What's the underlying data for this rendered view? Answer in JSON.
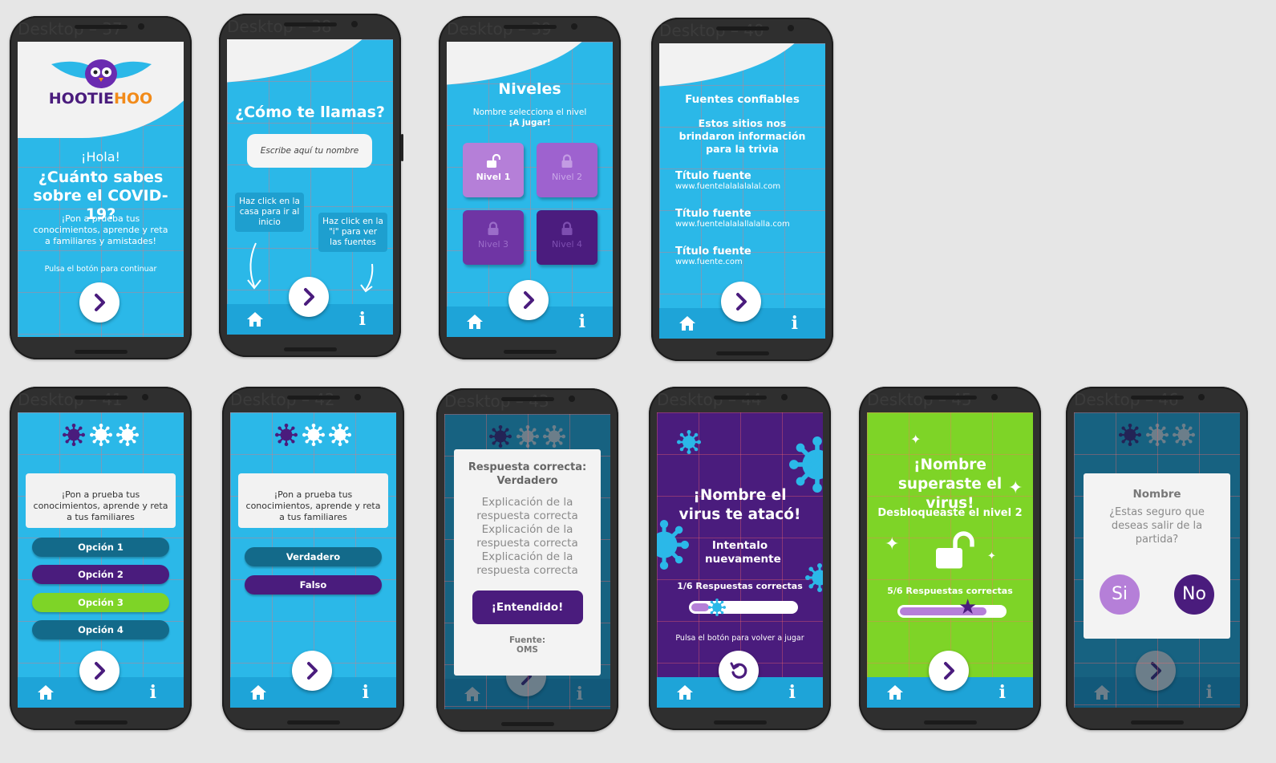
{
  "ghost_labels": [
    "Desktop – 37",
    "Desktop – 38",
    "Desktop – 39",
    "Desktop – 40",
    "Desktop – 41",
    "Desktop – 42",
    "Desktop – 43",
    "Desktop – 44",
    "Desktop – 45",
    "Desktop – 46"
  ],
  "colors": {
    "cyan": "#2bb8e8",
    "navbar": "#1ea4d8",
    "purple": "#4a1c7d",
    "green": "#7ed427",
    "teal": "#136a8a"
  },
  "s1": {
    "logo_hootie": "HOOTIE",
    "logo_hoo": "HOO",
    "greeting": "¡Hola!",
    "title": "¿Cuánto sabes sobre el COVID-19?",
    "subtitle": "¡Pon a prueba tus conocimientos, aprende y reta a familiares y amistades!",
    "hint": "Pulsa el botón para continuar"
  },
  "s2": {
    "title": "¿Cómo te llamas?",
    "name_placeholder": "Escribe aquí tu nombre",
    "tip_home": "Haz click en la casa para ir al inicio",
    "tip_info": "Haz click en la \"i\" para ver las fuentes"
  },
  "s3": {
    "title": "Niveles",
    "subtitle": "Nombre selecciona el nivel",
    "subtitle_bold": "¡A jugar!",
    "levels": [
      "Nivel 1",
      "Nivel 2",
      "Nivel 3",
      "Nivel 4"
    ]
  },
  "s4": {
    "title": "Fuentes confiables",
    "subtitle": "Estos sitios nos brindaron información para la trivia",
    "sources": [
      {
        "title": "Título fuente",
        "url": "www.fuentelalalalalal.com"
      },
      {
        "title": "Título fuente",
        "url": "www.fuentelalalallalalla.com"
      },
      {
        "title": "Título fuente",
        "url": "www.fuente.com"
      }
    ]
  },
  "s5": {
    "question": "¡Pon a prueba tus conocimientos, aprende y reta a tus familiares",
    "options": [
      "Opción 1",
      "Opción 2",
      "Opción 3",
      "Opción 4"
    ]
  },
  "s6": {
    "question": "¡Pon a prueba tus conocimientos, aprende y reta a tus familiares",
    "options": [
      "Verdadero",
      "Falso"
    ]
  },
  "s7": {
    "title": "Respuesta correcta: Verdadero",
    "explanation": "Explicación de la respuesta correcta Explicación de la respuesta correcta Explicación de la respuesta correcta",
    "button": "¡Entendido!",
    "source_label": "Fuente:",
    "source": "OMS"
  },
  "s8": {
    "title": "¡Nombre el virus te atacó!",
    "subtitle": "Intentalo nuevamente",
    "score": "1/6 Respuestas correctas",
    "score_fraction": 0.1667,
    "hint": "Pulsa el botón para volver a jugar"
  },
  "s9": {
    "title": "¡Nombre superaste el virus!",
    "subtitle": "Desbloqueaste el nivel 2",
    "score": "5/6 Respuestas correctas",
    "score_fraction": 0.8333
  },
  "s10": {
    "title": "Nombre",
    "question": "¿Estas seguro que deseas salir de la partida?",
    "yes": "Si",
    "no": "No"
  },
  "info_glyph": "i"
}
